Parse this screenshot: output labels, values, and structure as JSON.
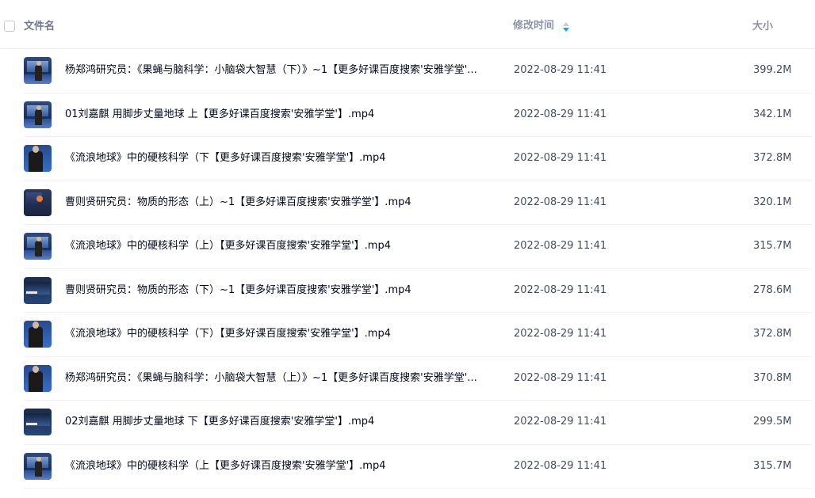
{
  "header": {
    "name_label": "文件名",
    "time_label": "修改时间",
    "size_label": "大小",
    "sort_icon": "sort-toggle-icon",
    "accent_color": "#06a7ff"
  },
  "files": [
    {
      "name": "杨郑鸿研究员：《果蝇与脑科学：小脑袋大智慧（下）》~1【更多好课百度搜索'安雅学堂'...",
      "time": "2022-08-29 11:41",
      "size": "399.2M",
      "thumb": "lecture-hall-thumbnail"
    },
    {
      "name": "01刘嘉麒 用脚步丈量地球 上【更多好课百度搜索'安雅学堂'】.mp4",
      "time": "2022-08-29 11:41",
      "size": "342.1M",
      "thumb": "lecture-hall-thumbnail"
    },
    {
      "name": "《流浪地球》中的硬核科学（下【更多好课百度搜索'安雅学堂'】.mp4",
      "time": "2022-08-29 11:41",
      "size": "372.8M",
      "thumb": "speaker-portrait-thumbnail"
    },
    {
      "name": "曹则贤研究员：物质的形态（上）~1【更多好课百度搜索'安雅学堂'】.mp4",
      "time": "2022-08-29 11:41",
      "size": "320.1M",
      "thumb": "slide-thumbnail"
    },
    {
      "name": "《流浪地球》中的硬核科学（上）【更多好课百度搜索'安雅学堂'】.mp4",
      "time": "2022-08-29 11:41",
      "size": "315.7M",
      "thumb": "lecture-hall-thumbnail"
    },
    {
      "name": "曹则贤研究员：物质的形态（下）~1【更多好课百度搜索'安雅学堂'】.mp4",
      "time": "2022-08-29 11:41",
      "size": "278.6M",
      "thumb": "screen-thumbnail"
    },
    {
      "name": "《流浪地球》中的硬核科学（下）【更多好课百度搜索'安雅学堂'】.mp4",
      "time": "2022-08-29 11:41",
      "size": "372.8M",
      "thumb": "speaker-portrait-thumbnail"
    },
    {
      "name": "杨郑鸿研究员：《果蝇与脑科学：小脑袋大智慧（上）》~1【更多好课百度搜索'安雅学堂'...",
      "time": "2022-08-29 11:41",
      "size": "370.8M",
      "thumb": "speaker-portrait-thumbnail"
    },
    {
      "name": "02刘嘉麒 用脚步丈量地球 下【更多好课百度搜索'安雅学堂'】.mp4",
      "time": "2022-08-29 11:41",
      "size": "299.5M",
      "thumb": "screen-thumbnail"
    },
    {
      "name": "《流浪地球》中的硬核科学（上【更多好课百度搜索'安雅学堂'】.mp4",
      "time": "2022-08-29 11:41",
      "size": "315.7M",
      "thumb": "lecture-hall-thumbnail"
    }
  ]
}
